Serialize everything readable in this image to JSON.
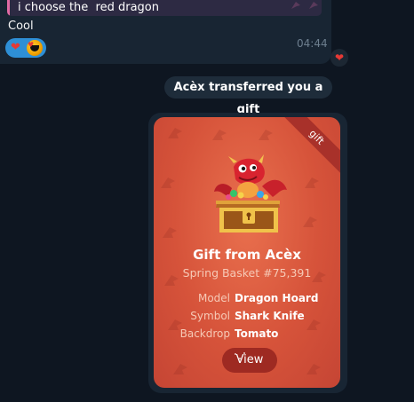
{
  "incoming_message": {
    "reply_preview_text": "i choose the  red dragon",
    "text": "Cool",
    "time": "04:44",
    "reactions": [
      "heart",
      "avatar"
    ]
  },
  "service_message": {
    "text": "Acèx transferred you a gift"
  },
  "gift": {
    "ribbon": "gift",
    "title": "Gift from Acèx",
    "subtitle": "Spring Basket #75,391",
    "attributes": [
      {
        "key": "Model",
        "value": "Dragon Hoard"
      },
      {
        "key": "Symbol",
        "value": "Shark Knife"
      },
      {
        "key": "Backdrop",
        "value": "Tomato"
      }
    ],
    "view_label": "View",
    "illustration": "dragon-on-treasure-chest",
    "pattern_icon": "shark-knife-icon"
  },
  "colors": {
    "chat_background": "#0e1621",
    "bubble": "#182533",
    "reply_accent": "#e16aa4",
    "reaction_pill": "#2e8fd6",
    "gift_backdrop": "#d6533a",
    "view_button": "#9e2a22"
  }
}
